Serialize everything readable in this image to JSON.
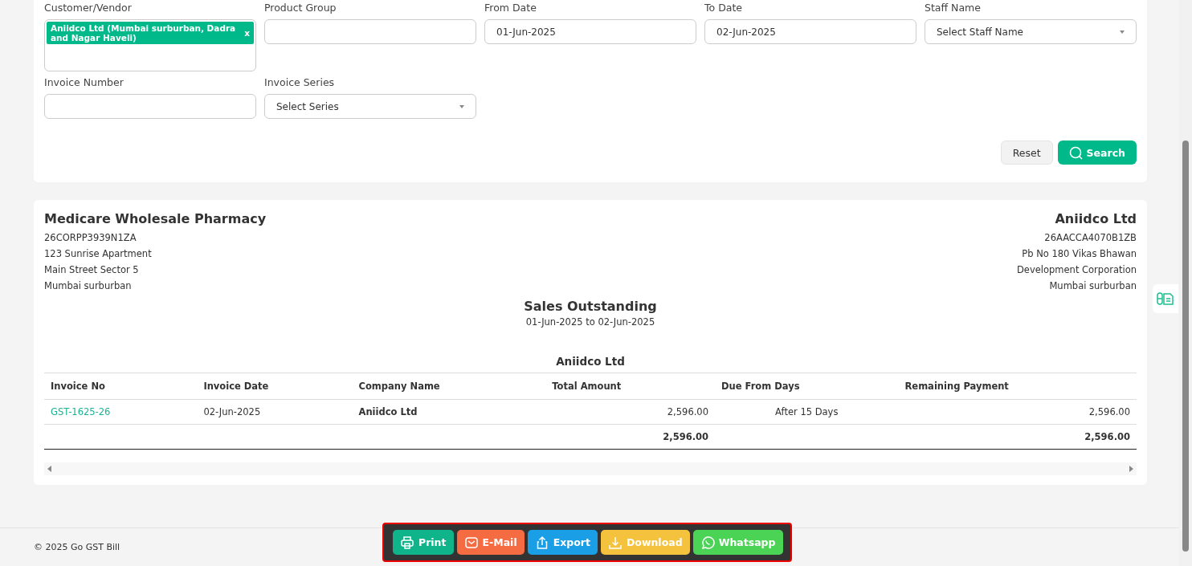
{
  "filters": {
    "customer_vendor": {
      "label": "Customer/Vendor",
      "tags": [
        {
          "text": "Aniidco Ltd (Mumbai surburban, Dadra and Nagar Haveli)",
          "remove": "x"
        }
      ]
    },
    "product_group": {
      "label": "Product Group"
    },
    "from_date": {
      "label": "From Date",
      "value": "01-Jun-2025"
    },
    "to_date": {
      "label": "To Date",
      "value": "02-Jun-2025"
    },
    "staff_name": {
      "label": "Staff Name",
      "placeholder": "Select Staff Name"
    },
    "invoice_number": {
      "label": "Invoice Number"
    },
    "invoice_series": {
      "label": "Invoice Series",
      "placeholder": "Select Series"
    },
    "buttons": {
      "reset": "Reset",
      "search": "Search"
    }
  },
  "report": {
    "seller": {
      "name": "Medicare Wholesale Pharmacy",
      "lines": [
        "26CORPP3939N1ZA",
        "123 Sunrise Apartment",
        "Main Street Sector 5",
        "Mumbai surburban"
      ]
    },
    "buyer": {
      "name": "Aniidco Ltd",
      "lines": [
        "26AACCA4070B1ZB",
        "Pb No 180 Vikas Bhawan",
        "Development Corporation",
        "Mumbai surburban"
      ]
    },
    "title": "Sales Outstanding",
    "period": "01-Jun-2025 to 02-Jun-2025",
    "group": "Aniidco Ltd",
    "columns": [
      "Invoice No",
      "Invoice Date",
      "Company Name",
      "Total Amount",
      "Due From Days",
      "Remaining Payment"
    ],
    "rows": [
      {
        "invoice_no": "GST-1625-26",
        "invoice_date": "02-Jun-2025",
        "company_name": "Aniidco Ltd",
        "total_amount": "2,596.00",
        "due_from_days": "After 15 Days",
        "remaining_payment": "2,596.00"
      }
    ],
    "totals": {
      "total_amount": "2,596.00",
      "remaining_payment": "2,596.00"
    }
  },
  "footer": {
    "copyright": "© 2025 Go GST Bill"
  },
  "actions": [
    {
      "kind": "print",
      "label": "Print",
      "color": "#0fb48a"
    },
    {
      "kind": "email",
      "label": "E-Mail",
      "color": "#f56c42"
    },
    {
      "kind": "export",
      "label": "Export",
      "color": "#1a9fe6"
    },
    {
      "kind": "download",
      "label": "Download",
      "color": "#f5c23d"
    },
    {
      "kind": "whatsapp",
      "label": "Whatsapp",
      "color": "#4bd356"
    }
  ]
}
